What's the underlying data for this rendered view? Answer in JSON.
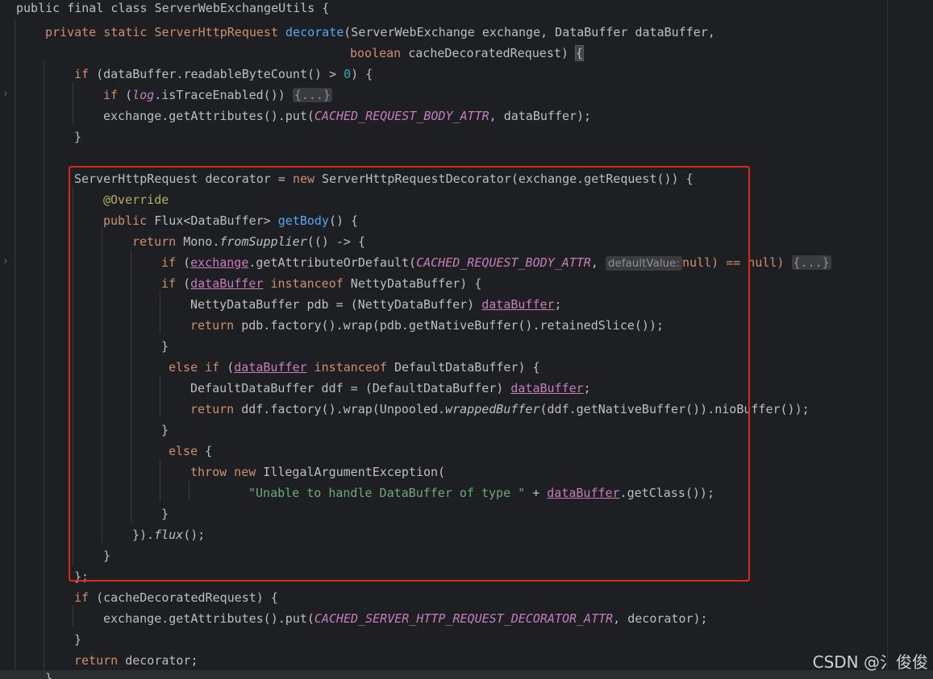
{
  "editor": {
    "watermark": "CSDN @氵俊俊",
    "hint_label": "defaultValue:",
    "lines": {
      "l0": "public final class ServerWebExchangeUtils {",
      "l1a": "private static ServerHttpRequest",
      "l1b": "decorate",
      "l1c": "(ServerWebExchange exchange, DataBuffer dataBuffer,",
      "l2a": "boolean",
      "l2b": " cacheDecoratedRequest) ",
      "l2c": "{",
      "l3a": "if",
      "l3b": " (dataBuffer.readableByteCount() > ",
      "l3c": "0",
      "l3d": ") {",
      "l4a": "if",
      "l4b": " (",
      "l4c": "log",
      "l4d": ".isTraceEnabled()) ",
      "l4e": "{...}",
      "l5a": "exchange.getAttributes().put(",
      "l5b": "CACHED_REQUEST_BODY_ATTR",
      "l5c": ", dataBuffer);",
      "l6": "}",
      "l8a": "ServerHttpRequest decorator = ",
      "l8b": "new",
      "l8c": " ServerHttpRequestDecorator(exchange.getRequest()) {",
      "l9": "@Override",
      "l10a": "public",
      "l10b": " Flux<DataBuffer> ",
      "l10c": "getBody",
      "l10d": "() {",
      "l11a": "return",
      "l11b": " Mono.",
      "l11c": "fromSupplier",
      "l11d": "(() -> {",
      "l12a": "if",
      "l12b": " (",
      "l12c": "exchange",
      "l12d": ".getAttributeOrDefault(",
      "l12e": "CACHED_REQUEST_BODY_ATTR",
      "l12f": ", ",
      "l12g": "null) == null) ",
      "l12h": "{...}",
      "l13a": "if",
      "l13b": " (",
      "l13c": "dataBuffer",
      "l13d": "instanceof",
      "l13e": " NettyDataBuffer) {",
      "l14a": "NettyDataBuffer pdb = (NettyDataBuffer) ",
      "l14b": "dataBuffer",
      "l14c": ";",
      "l15a": "return",
      "l15b": " pdb.factory().wrap(pdb.getNativeBuffer().retainedSlice());",
      "l16": "}",
      "l17a": "else if",
      "l17b": " (",
      "l17c": "dataBuffer",
      "l17d": "instanceof",
      "l17e": " DefaultDataBuffer) {",
      "l18a": "DefaultDataBuffer ddf = (DefaultDataBuffer) ",
      "l18b": "dataBuffer",
      "l18c": ";",
      "l19a": "return",
      "l19b": " ddf.factory().wrap(Unpooled.",
      "l19c": "wrappedBuffer",
      "l19d": "(ddf.getNativeBuffer()).nioBuffer());",
      "l20": "}",
      "l21a": "else",
      "l21b": " {",
      "l22a": "throw new",
      "l22b": " IllegalArgumentException(",
      "l23a": "\"Unable to handle DataBuffer of type \"",
      "l23b": " + ",
      "l23c": "dataBuffer",
      "l23d": ".getClass());",
      "l24": "}",
      "l25a": "}).",
      "l25b": "flux",
      "l25c": "();",
      "l26": "}",
      "l27": "};",
      "l28a": "if",
      "l28b": " (cacheDecoratedRequest) {",
      "l29a": "exchange.getAttributes().put(",
      "l29b": "CACHED_SERVER_HTTP_REQUEST_DECORATOR_ATTR",
      "l29c": ", decorator);",
      "l30": "}",
      "l31a": "return",
      "l31b": " decorator;",
      "l32": "}"
    }
  }
}
